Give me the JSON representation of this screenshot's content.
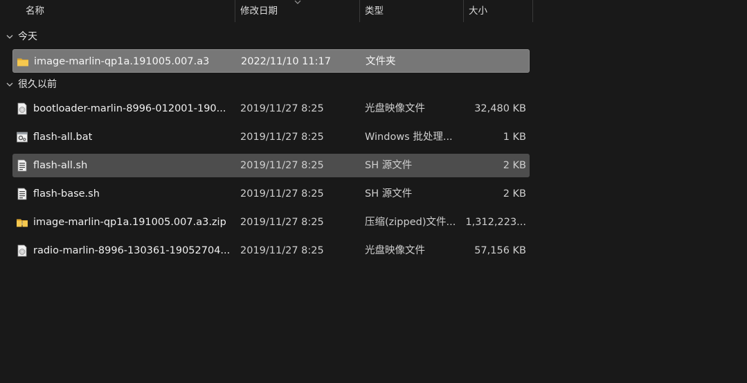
{
  "columns": {
    "name": "名称",
    "date": "修改日期",
    "type": "类型",
    "size": "大小"
  },
  "groups": [
    {
      "label": "今天",
      "rows": [
        {
          "name": "image-marlin-qp1a.191005.007.a3",
          "date": "2022/11/10 11:17",
          "type": "文件夹",
          "size": "",
          "icon": "folder-icon",
          "state": "selected"
        }
      ]
    },
    {
      "label": "很久以前",
      "rows": [
        {
          "name": "bootloader-marlin-8996-012001-190...",
          "date": "2019/11/27 8:25",
          "type": "光盘映像文件",
          "size": "32,480 KB",
          "icon": "disc-image-icon",
          "state": ""
        },
        {
          "name": "flash-all.bat",
          "date": "2019/11/27 8:25",
          "type": "Windows 批处理...",
          "size": "1 KB",
          "icon": "batch-file-icon",
          "state": ""
        },
        {
          "name": "flash-all.sh",
          "date": "2019/11/27 8:25",
          "type": "SH 源文件",
          "size": "2 KB",
          "icon": "script-file-icon",
          "state": "hover"
        },
        {
          "name": "flash-base.sh",
          "date": "2019/11/27 8:25",
          "type": "SH 源文件",
          "size": "2 KB",
          "icon": "script-file-icon",
          "state": ""
        },
        {
          "name": "image-marlin-qp1a.191005.007.a3.zip",
          "date": "2019/11/27 8:25",
          "type": "压缩(zipped)文件...",
          "size": "1,312,223...",
          "icon": "zip-folder-icon",
          "state": ""
        },
        {
          "name": "radio-marlin-8996-130361-19052704...",
          "date": "2019/11/27 8:25",
          "type": "光盘映像文件",
          "size": "57,156 KB",
          "icon": "disc-image-icon",
          "state": ""
        }
      ]
    }
  ],
  "colors": {
    "background": "#191919",
    "selected": "#777777",
    "hover": "#4d4d4d",
    "folder": "#f2c14e"
  }
}
